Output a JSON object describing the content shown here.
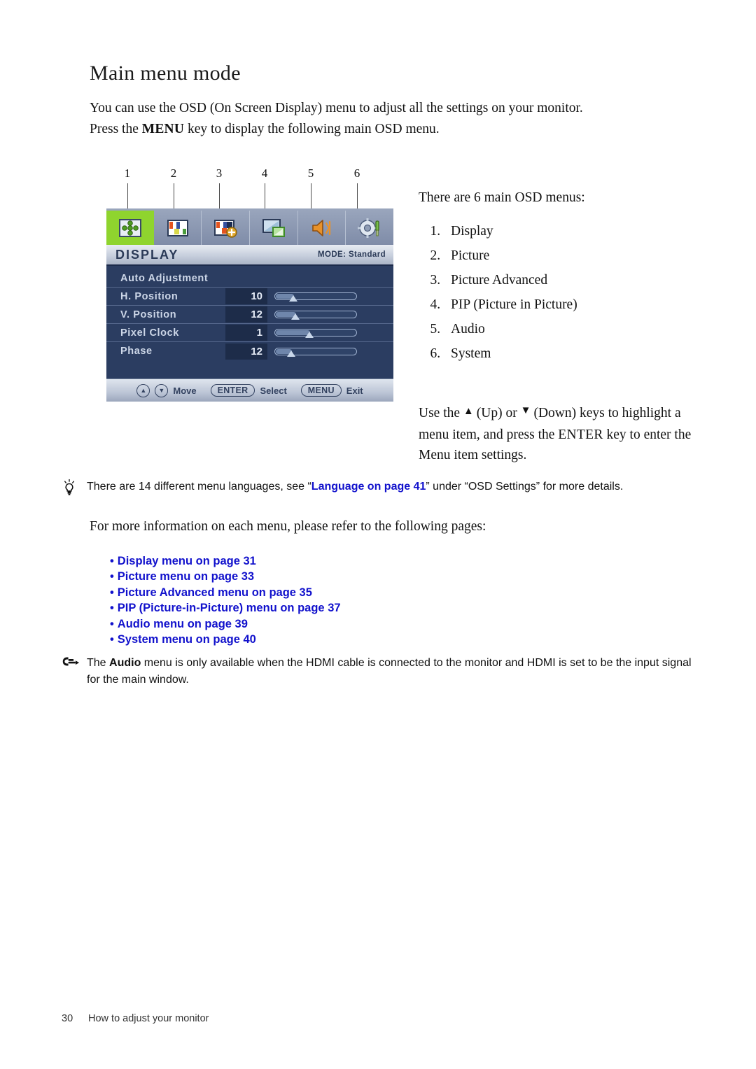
{
  "page": {
    "heading": "Main menu mode",
    "intro_line1_a": "You can use the OSD (On Screen Display) menu to adjust all the settings on your monitor.",
    "intro_line2_a": "Press the ",
    "intro_line2_kbd": "MENU",
    "intro_line2_b": " key to display the following main OSD menu."
  },
  "right_column": {
    "lead": "There are 6 main OSD menus:",
    "menus": [
      "Display",
      "Picture",
      "Picture Advanced",
      "PIP (Picture in Picture)",
      "Audio",
      "System"
    ],
    "use_keys": {
      "a": "Use the ",
      "up_arrow": "▲",
      "b": " (Up) or ",
      "down_arrow": "▼",
      "c": " (Down) keys to highlight a menu item, and press the ",
      "enter_kbd": "ENTER",
      "d": " key to enter the Menu item settings."
    }
  },
  "osd_figure": {
    "callouts": [
      "1",
      "2",
      "3",
      "4",
      "5",
      "6"
    ],
    "tabs": [
      {
        "icon": "display-icon",
        "label": "Display",
        "active": true
      },
      {
        "icon": "picture-icon",
        "label": "Picture",
        "active": false
      },
      {
        "icon": "picture-advanced-icon",
        "label": "Picture Advanced",
        "active": false
      },
      {
        "icon": "pip-icon",
        "label": "PIP",
        "active": false
      },
      {
        "icon": "audio-speaker-icon",
        "label": "Audio",
        "active": false
      },
      {
        "icon": "system-gear-icon",
        "label": "System",
        "active": false
      }
    ],
    "title": "DISPLAY",
    "mode": "MODE: Standard",
    "rows": [
      {
        "label": "Auto Adjustment",
        "value": "",
        "percent": null
      },
      {
        "label": "H. Position",
        "value": "10",
        "percent": 22
      },
      {
        "label": "V. Position",
        "value": "12",
        "percent": 25
      },
      {
        "label": "Pixel Clock",
        "value": "1",
        "percent": 42
      },
      {
        "label": "Phase",
        "value": "12",
        "percent": 20
      }
    ],
    "footer": {
      "up_key": "▲",
      "down_key": "▼",
      "move": "Move",
      "enter": "ENTER",
      "select": "Select",
      "menu": "MENU",
      "exit": "Exit"
    },
    "active_tab_color": "#8fd42e"
  },
  "note_language": {
    "icon": "lightbulb-icon",
    "text_a": "There are 14 different menu languages, see “",
    "link": "Language on page 41",
    "text_b": "” under “OSD Settings” for more details."
  },
  "for_more_info": "For more information on each menu, please refer to the following pages:",
  "link_list": [
    "Display menu on page 31",
    "Picture menu on page 33",
    "Picture Advanced menu on page 35",
    "PIP (Picture-in-Picture) menu on page 37",
    "Audio menu on page 39",
    "System menu on page 40"
  ],
  "note_audio": {
    "icon": "pointing-hand-icon",
    "text_a": "The ",
    "bold": "Audio",
    "text_b": " menu is only available when the HDMI cable is connected to the monitor and HDMI is set to be the input signal for the main window."
  },
  "footer": {
    "page_number": "30",
    "section": "How to adjust your monitor"
  },
  "colors": {
    "link_blue": "#1111cc",
    "osd_body": "#2b3d61",
    "osd_active_tab": "#8fd42e"
  }
}
